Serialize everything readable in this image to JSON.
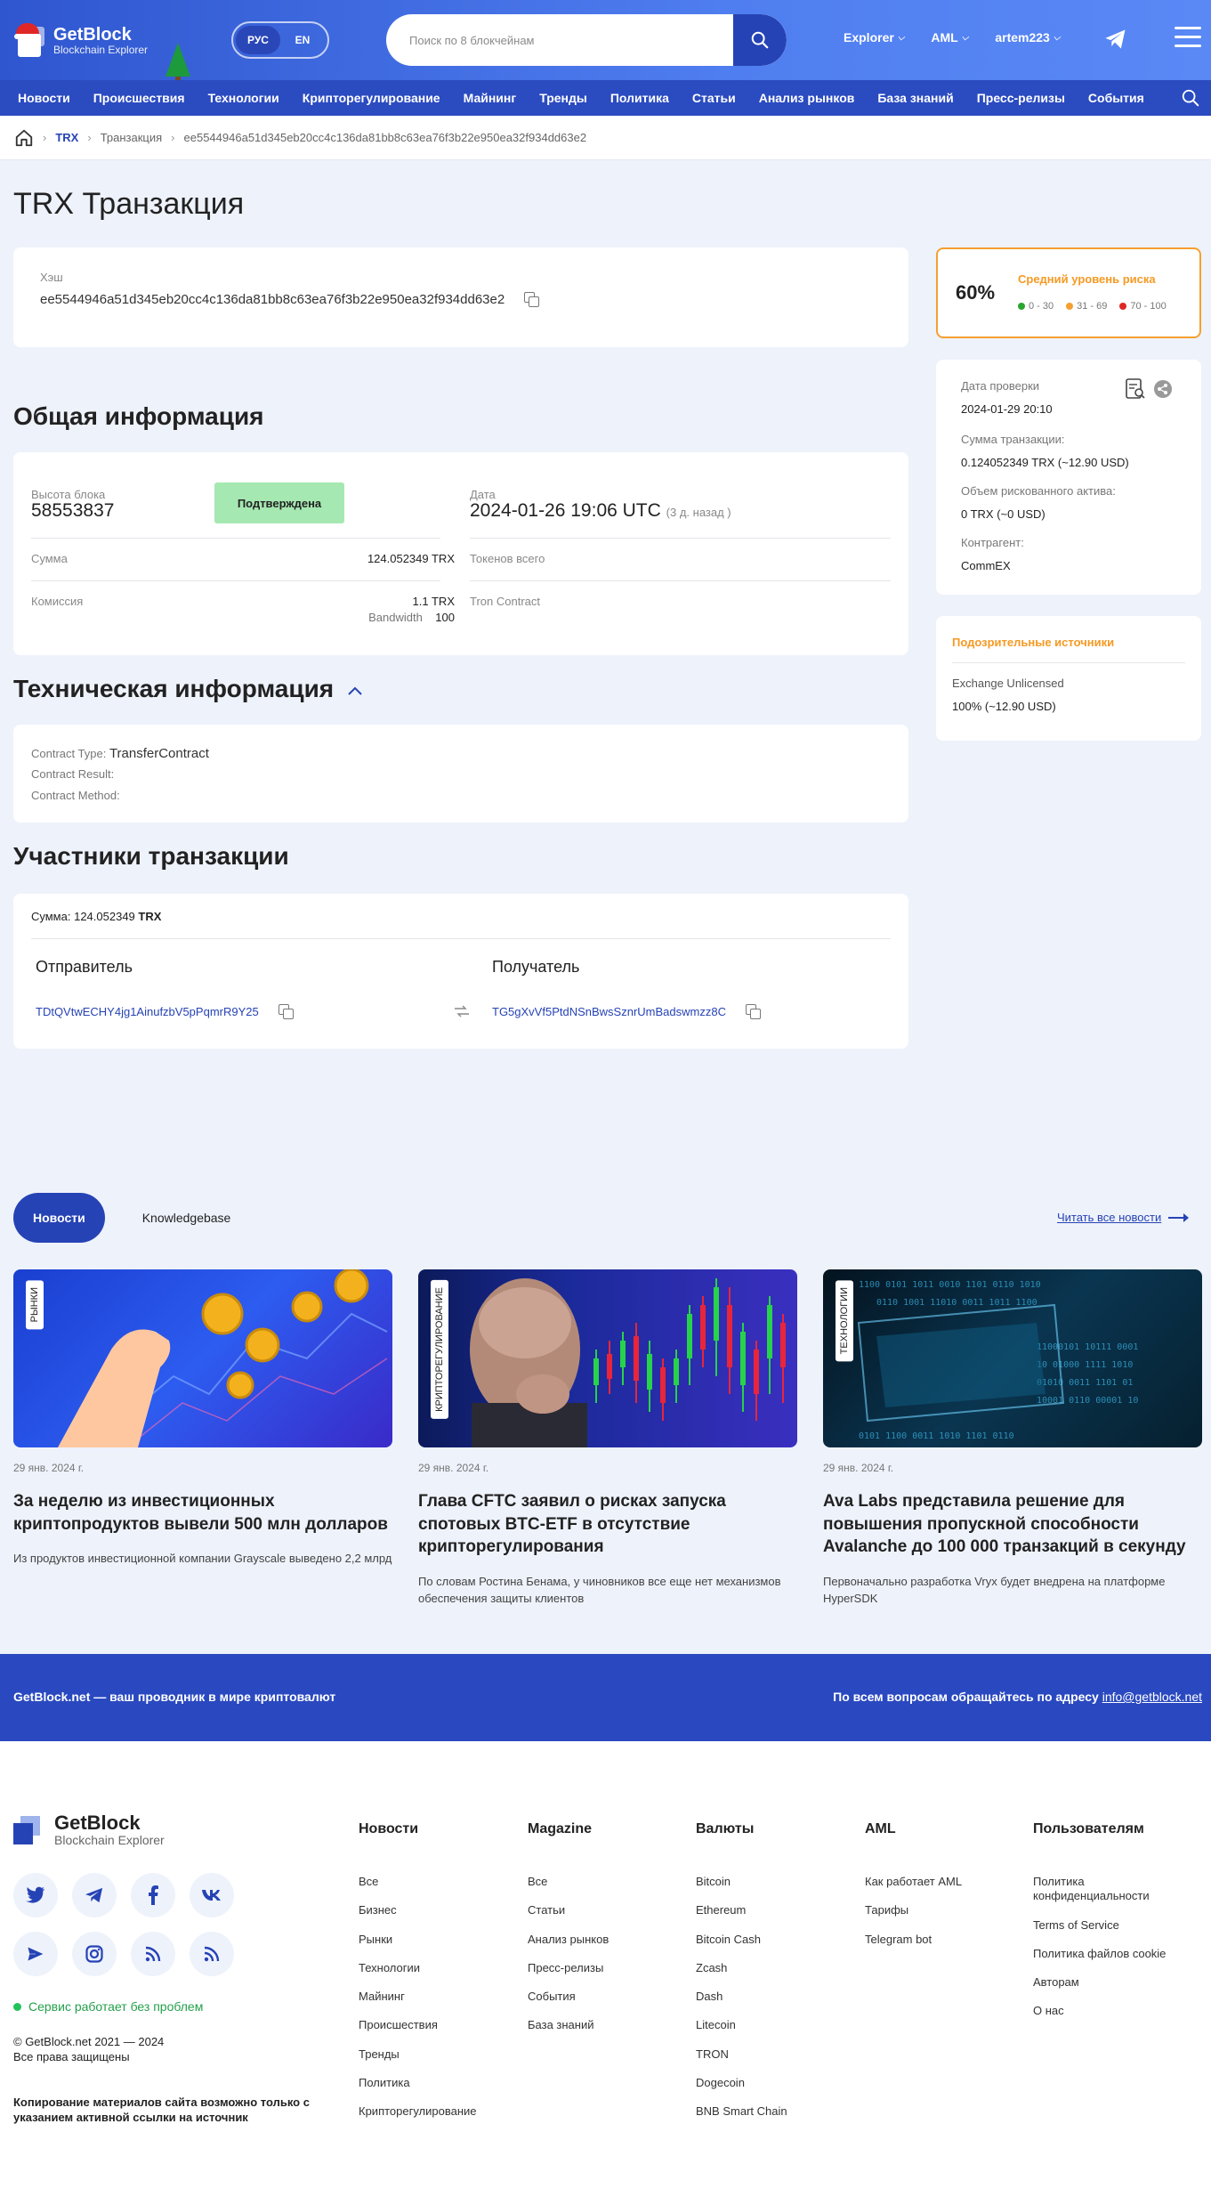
{
  "header": {
    "logo_title": "GetBlock",
    "logo_subtitle": "Blockchain Explorer",
    "lang": [
      "РУС",
      "EN"
    ],
    "search_placeholder": "Поиск по 8 блокчейнам",
    "nav": [
      "Explorer",
      "AML",
      "artem223"
    ]
  },
  "categories": [
    "Новости",
    "Происшествия",
    "Технологии",
    "Крипторегулирование",
    "Майнинг",
    "Тренды",
    "Политика",
    "Статьи",
    "Анализ рынков",
    "База знаний",
    "Пресс-релизы",
    "События"
  ],
  "breadcrumb": {
    "coin": "TRX",
    "section": "Транзакция",
    "hash": "ee5544946a51d345eb20cc4c136da81bb8c63ea76f3b22e950ea32f934dd63e2"
  },
  "page_title": "TRX Транзакция",
  "hash_card": {
    "label": "Хэш",
    "value": "ee5544946a51d345eb20cc4c136da81bb8c63ea76f3b22e950ea32f934dd63e2"
  },
  "general": {
    "heading": "Общая информация",
    "block_height_label": "Высота блока",
    "block_height": "58553837",
    "status": "Подтверждена",
    "date_label": "Дата",
    "date": "2024-01-26 19:06 UTC",
    "date_ago": "(3 д. назад )",
    "amount_label": "Сумма",
    "amount": "124.052349 TRX",
    "tokens_label": "Токенов всего",
    "fee_label": "Комиссия",
    "fee": "1.1 TRX",
    "bandwidth_label": "Bandwidth",
    "bandwidth": "100",
    "contract_label": "Tron Contract"
  },
  "technical": {
    "heading": "Техническая информация",
    "contract_type_label": "Contract Type:",
    "contract_type": "TransferContract",
    "contract_result_label": "Contract Result:",
    "contract_method_label": "Contract Method:"
  },
  "participants": {
    "heading": "Участники транзакции",
    "sum_label": "Сумма:",
    "sum_value": "124.052349",
    "sum_unit": "TRX",
    "sender_label": "Отправитель",
    "sender": "TDtQVtwECHY4jg1AinufzbV5pPqmrR9Y25",
    "receiver_label": "Получатель",
    "receiver": "TG5gXvVf5PtdNSnBwsSznrUmBadswmzz8C"
  },
  "risk": {
    "percent": "60%",
    "title": "Средний уровень риска",
    "legend": [
      "0 - 30",
      "31 - 69",
      "70 - 100"
    ],
    "colors": [
      "#2aa52e",
      "#f5a030",
      "#e02727"
    ]
  },
  "check_info": {
    "check_date_label": "Дата проверки",
    "check_date": "2024-01-29 20:10",
    "sum_label": "Сумма транзакции:",
    "sum": "0.124052349 TRX (~12.90 USD)",
    "risky_label": "Объем рискованного актива:",
    "risky": "0 TRX (~0 USD)",
    "counterparty_label": "Контрагент:",
    "counterparty": "CommEX"
  },
  "suspicious": {
    "title": "Подозрительные источники",
    "source": "Exchange Unlicensed",
    "value": "100% (~12.90 USD)"
  },
  "news_section": {
    "tabs": [
      "Новости",
      "Knowledgebase"
    ],
    "read_all": "Читать все новости",
    "items": [
      {
        "tag": "РЫНКИ",
        "date": "29 янв. 2024 г.",
        "title": "За неделю из инвестиционных криптопродуктов вывели 500 млн долларов",
        "desc": "Из продуктов инвестиционной компании Grayscale выведено 2,2 млрд"
      },
      {
        "tag": "КРИПТОРЕГУЛИРОВАНИЕ",
        "date": "29 янв. 2024 г.",
        "title": "Глава CFTC заявил о рисках запуска спотовых BTC-ETF в отсутствие крипторегулирования",
        "desc": "По словам Ростина Бенама, у чиновников все еще нет механизмов обеспечения защиты клиентов"
      },
      {
        "tag": "ТЕХНОЛОГИИ",
        "date": "29 янв. 2024 г.",
        "title": "Ava Labs представила решение для повышения пропускной способности Avalanche до 100 000 транзакций в секунду",
        "desc": "Первоначально разработка Vryx будет внедрена на платформе HyperSDK"
      }
    ]
  },
  "banner": {
    "left": "GetBlock.net — ваш проводник в мире криптовалют",
    "right": "По всем вопросам обращайтесь по адресу",
    "email": "info@getblock.net"
  },
  "footer": {
    "logo_title": "GetBlock",
    "logo_subtitle": "Blockchain Explorer",
    "status": "Сервис работает без проблем",
    "copyright": "© GetBlock.net 2021 — 2024",
    "rights": "Все права защищены",
    "copy_note": "Копирование материалов сайта возможно только с указанием активной ссылки на источник",
    "columns": [
      {
        "title": "Новости",
        "items": [
          "Все",
          "Бизнес",
          "Рынки",
          "Технологии",
          "Майнинг",
          "Происшествия",
          "Тренды",
          "Политика",
          "Крипторегулирование"
        ]
      },
      {
        "title": "Magazine",
        "items": [
          "Все",
          "Статьи",
          "Анализ рынков",
          "Пресс-релизы",
          "События",
          "База знаний"
        ]
      },
      {
        "title": "Валюты",
        "items": [
          "Bitcoin",
          "Ethereum",
          "Bitcoin Cash",
          "Zcash",
          "Dash",
          "Litecoin",
          "TRON",
          "Dogecoin",
          "BNB Smart Chain"
        ]
      },
      {
        "title": "AML",
        "items": [
          "Как работает AML",
          "Тарифы",
          "Telegram bot"
        ]
      },
      {
        "title": "Пользователям",
        "items": [
          "Политика конфиденциальности",
          "Terms of Service",
          "Политика файлов cookie",
          "Авторам",
          "О нас"
        ]
      }
    ]
  }
}
